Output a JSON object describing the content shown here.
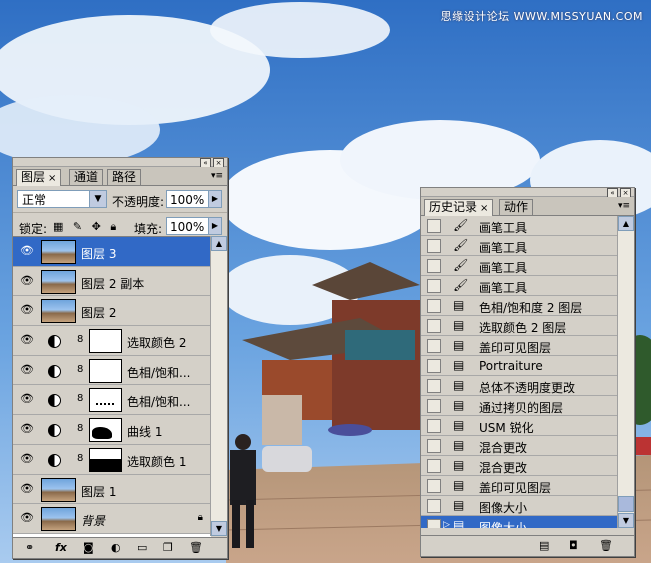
{
  "watermark": "思缘设计论坛 WWW.MISSYUAN.COM",
  "layers_panel": {
    "tabs": [
      {
        "label": "图层",
        "active": true,
        "close": "×"
      },
      {
        "label": "通道",
        "active": false
      },
      {
        "label": "路径",
        "active": false
      }
    ],
    "blend_mode": "正常",
    "opacity_label": "不透明度:",
    "opacity_value": "100%",
    "lock_label": "锁定:",
    "fill_label": "填充:",
    "fill_value": "100%",
    "layers": [
      {
        "name": "图层 3",
        "kind": "image",
        "selected": true
      },
      {
        "name": "图层 2 副本",
        "kind": "image"
      },
      {
        "name": "图层 2",
        "kind": "image"
      },
      {
        "name": "选取颜色 2",
        "kind": "adjustment",
        "mask": "white"
      },
      {
        "name": "色相/饱和...",
        "kind": "adjustment",
        "mask": "white"
      },
      {
        "name": "色相/饱和...",
        "kind": "adjustment",
        "mask": "dots"
      },
      {
        "name": "曲线 1",
        "kind": "adjustment",
        "mask": "blob"
      },
      {
        "name": "选取颜色 1",
        "kind": "adjustment",
        "mask": "silhouette"
      },
      {
        "name": "图层 1",
        "kind": "image"
      },
      {
        "name": "背景",
        "kind": "image",
        "locked": true,
        "italic": true
      }
    ],
    "bottom_icons": [
      "link-icon",
      "fx-icon",
      "mask-icon",
      "adjustment-icon",
      "folder-icon",
      "new-layer-icon",
      "trash-icon"
    ]
  },
  "history_panel": {
    "tabs": [
      {
        "label": "历史记录",
        "active": true,
        "close": "×"
      },
      {
        "label": "动作",
        "active": false
      }
    ],
    "items": [
      {
        "name": "画笔工具",
        "icon": "brush"
      },
      {
        "name": "画笔工具",
        "icon": "brush"
      },
      {
        "name": "画笔工具",
        "icon": "brush"
      },
      {
        "name": "画笔工具",
        "icon": "brush"
      },
      {
        "name": "色相/饱和度 2 图层",
        "icon": "doc"
      },
      {
        "name": "选取颜色 2 图层",
        "icon": "doc"
      },
      {
        "name": "盖印可见图层",
        "icon": "doc"
      },
      {
        "name": "Portraiture",
        "icon": "doc"
      },
      {
        "name": "总体不透明度更改",
        "icon": "doc"
      },
      {
        "name": "通过拷贝的图层",
        "icon": "doc"
      },
      {
        "name": "USM 锐化",
        "icon": "doc"
      },
      {
        "name": "混合更改",
        "icon": "doc"
      },
      {
        "name": "混合更改",
        "icon": "doc"
      },
      {
        "name": "盖印可见图层",
        "icon": "doc"
      },
      {
        "name": "图像大小",
        "icon": "doc"
      },
      {
        "name": "图像大小",
        "icon": "doc",
        "selected": true
      }
    ],
    "bottom_icons": [
      "new-document-icon",
      "snapshot-icon",
      "trash-icon"
    ]
  }
}
